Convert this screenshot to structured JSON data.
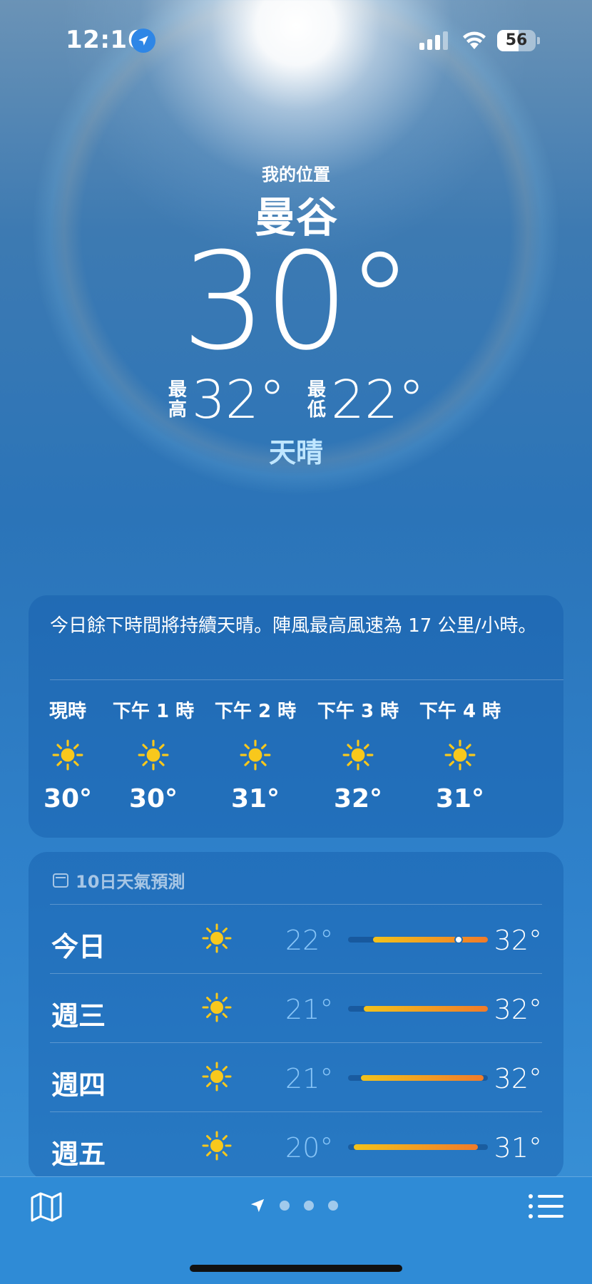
{
  "status_bar": {
    "time": "12:16",
    "battery": "56",
    "battery_level": 0.56
  },
  "header": {
    "my_location": "我的位置",
    "city": "曼谷",
    "temperature": "30°",
    "high_label": "最高",
    "high": "32°",
    "low_label": "最低",
    "low": "22°",
    "condition": "天晴"
  },
  "hourly": {
    "summary": "今日餘下時間將持續天晴。陣風最高風速為 17 公里/小時。",
    "hours": [
      {
        "label": "現時",
        "icon": "sun-icon",
        "temp": "30°"
      },
      {
        "label": "下午 1 時",
        "icon": "sun-icon",
        "temp": "30°"
      },
      {
        "label": "下午 2 時",
        "icon": "sun-icon",
        "temp": "31°"
      },
      {
        "label": "下午 3 時",
        "icon": "sun-icon",
        "temp": "32°"
      },
      {
        "label": "下午 4 時",
        "icon": "sun-icon",
        "temp": "31°"
      }
    ]
  },
  "forecast": {
    "title": "10日天氣預測",
    "icon": "calendar-icon",
    "days": [
      {
        "day": "今日",
        "icon": "sun-icon",
        "low": "22°",
        "high": "32°",
        "range_start": 0.18,
        "range_end": 1.0,
        "current": 0.79
      },
      {
        "day": "週三",
        "icon": "sun-icon",
        "low": "21°",
        "high": "32°",
        "range_start": 0.11,
        "range_end": 1.0
      },
      {
        "day": "週四",
        "icon": "sun-icon",
        "low": "21°",
        "high": "32°",
        "range_start": 0.09,
        "range_end": 0.97
      },
      {
        "day": "週五",
        "icon": "sun-icon",
        "low": "20°",
        "high": "31°",
        "range_start": 0.04,
        "range_end": 0.93
      }
    ]
  },
  "bottom_bar": {
    "left_icon": "map-icon",
    "right_icon": "list-icon",
    "page_count": 3
  },
  "colors": {
    "sun": "#F8C81C",
    "range_start": "#F2C21B",
    "range_end": "#F07B2A",
    "condition_text": "#BFE6FF"
  }
}
